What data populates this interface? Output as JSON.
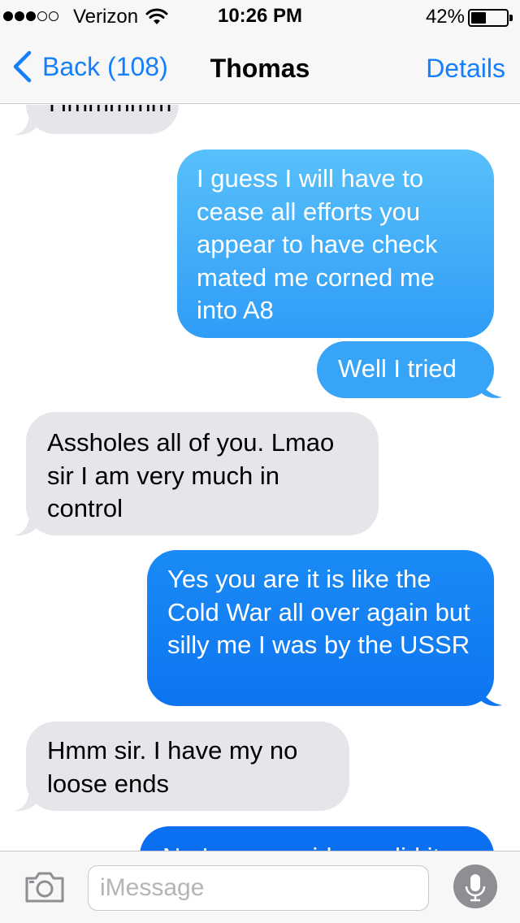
{
  "status_bar": {
    "carrier": "Verizon",
    "time": "10:26 PM",
    "battery_percent": "42%",
    "battery_level": 0.42,
    "signal_bars_filled": 3,
    "signal_bars_total": 5
  },
  "nav": {
    "back_label": "Back (108)",
    "title": "Thomas",
    "details_label": "Details"
  },
  "messages": [
    {
      "from": "contact",
      "text": "Hmmmmm"
    },
    {
      "from": "me",
      "text": "I guess I will have to cease all efforts you appear to have check mated me corned me into A8"
    },
    {
      "from": "me",
      "text": "Well I tried"
    },
    {
      "from": "contact",
      "text": "Assholes all of you. Lmao sir I am very much in control"
    },
    {
      "from": "me",
      "text": "Yes you are it is like the Cold War all over again but silly me I was by the USSR"
    },
    {
      "from": "contact",
      "text": "Hmm sir. I have my no loose ends"
    },
    {
      "from": "me",
      "text": "No I never said you did it"
    }
  ],
  "input": {
    "placeholder": "iMessage"
  },
  "icons": {
    "back": "chevron-left-icon",
    "camera": "camera-icon",
    "mic": "microphone-icon",
    "wifi": "wifi-icon",
    "battery": "battery-icon"
  },
  "colors": {
    "accent": "#157efb",
    "incoming_bubble": "#e5e5ea",
    "outgoing_gradient_top": "#56bdfa",
    "outgoing_gradient_bottom": "#0a6ff0",
    "nav_background": "#f7f7f7"
  }
}
